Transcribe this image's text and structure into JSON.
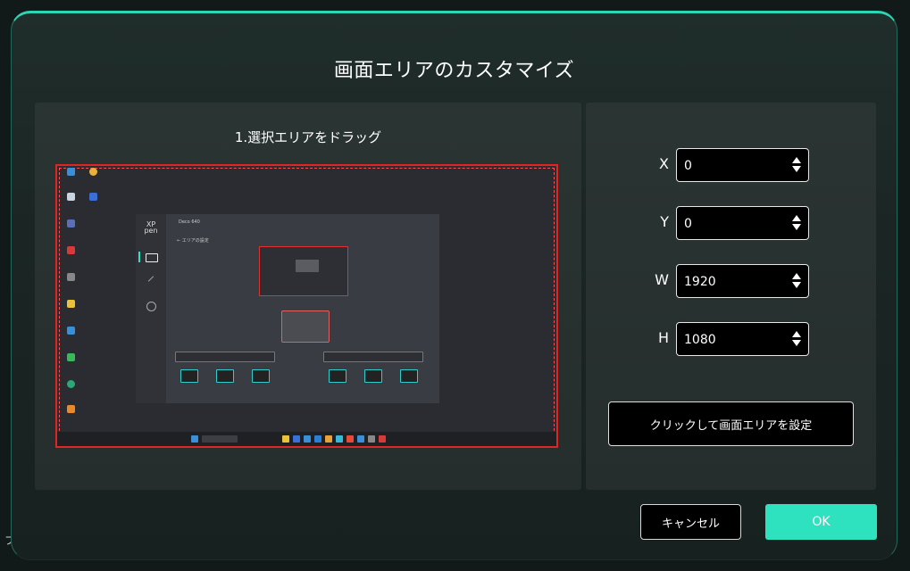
{
  "dialog": {
    "title": "画面エリアのカスタマイズ",
    "step_label": "1.選択エリアをドラッグ",
    "preview": {
      "app_logo": "XP pen",
      "app_window_title": "Deco 640",
      "app_subtitle": "← エリアの設定"
    },
    "fields": [
      {
        "label": "X",
        "value": "0"
      },
      {
        "label": "Y",
        "value": "0"
      },
      {
        "label": "W",
        "value": "1920"
      },
      {
        "label": "H",
        "value": "1080"
      }
    ],
    "set_area_button": "クリックして画面エリアを設定",
    "cancel_button": "キャンセル",
    "ok_button": "OK"
  },
  "background_fragment": "フ",
  "colors": {
    "accent": "#2fe2bf",
    "panel": "#27302f",
    "selection_border": "#e02525"
  }
}
